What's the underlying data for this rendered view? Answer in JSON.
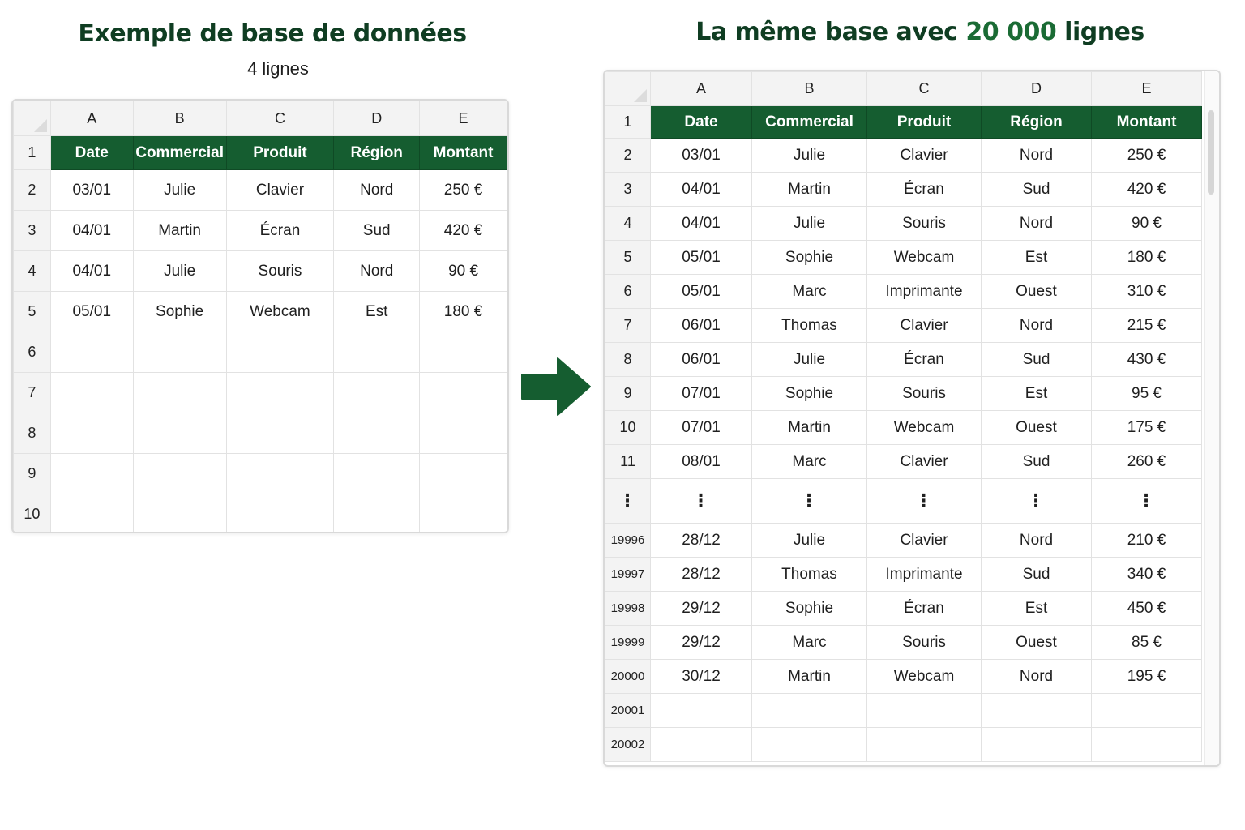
{
  "left": {
    "title": "Exemple de base de données",
    "subtitle": "4 lignes",
    "columns": [
      "A",
      "B",
      "C",
      "D",
      "E"
    ],
    "header_row_num": "1",
    "header": [
      "Date",
      "Commercial",
      "Produit",
      "Région",
      "Montant"
    ],
    "rows": [
      {
        "num": "2",
        "cells": [
          "03/01",
          "Julie",
          "Clavier",
          "Nord",
          "250 €"
        ]
      },
      {
        "num": "3",
        "cells": [
          "04/01",
          "Martin",
          "Écran",
          "Sud",
          "420 €"
        ]
      },
      {
        "num": "4",
        "cells": [
          "04/01",
          "Julie",
          "Souris",
          "Nord",
          "90 €"
        ]
      },
      {
        "num": "5",
        "cells": [
          "05/01",
          "Sophie",
          "Webcam",
          "Est",
          "180 €"
        ]
      },
      {
        "num": "6",
        "cells": [
          "",
          "",
          "",
          "",
          ""
        ]
      },
      {
        "num": "7",
        "cells": [
          "",
          "",
          "",
          "",
          ""
        ]
      },
      {
        "num": "8",
        "cells": [
          "",
          "",
          "",
          "",
          ""
        ]
      },
      {
        "num": "9",
        "cells": [
          "",
          "",
          "",
          "",
          ""
        ]
      },
      {
        "num": "10",
        "cells": [
          "",
          "",
          "",
          "",
          ""
        ]
      }
    ]
  },
  "right": {
    "title_prefix": "La même base avec ",
    "title_highlight": "20 000",
    "title_suffix": " lignes",
    "columns": [
      "A",
      "B",
      "C",
      "D",
      "E"
    ],
    "header_row_num": "1",
    "header": [
      "Date",
      "Commercial",
      "Produit",
      "Région",
      "Montant"
    ],
    "rows": [
      {
        "num": "2",
        "cells": [
          "03/01",
          "Julie",
          "Clavier",
          "Nord",
          "250 €"
        ]
      },
      {
        "num": "3",
        "cells": [
          "04/01",
          "Martin",
          "Écran",
          "Sud",
          "420 €"
        ]
      },
      {
        "num": "4",
        "cells": [
          "04/01",
          "Julie",
          "Souris",
          "Nord",
          "90 €"
        ]
      },
      {
        "num": "5",
        "cells": [
          "05/01",
          "Sophie",
          "Webcam",
          "Est",
          "180 €"
        ]
      },
      {
        "num": "6",
        "cells": [
          "05/01",
          "Marc",
          "Imprimante",
          "Ouest",
          "310 €"
        ]
      },
      {
        "num": "7",
        "cells": [
          "06/01",
          "Thomas",
          "Clavier",
          "Nord",
          "215 €"
        ]
      },
      {
        "num": "8",
        "cells": [
          "06/01",
          "Julie",
          "Écran",
          "Sud",
          "430 €"
        ]
      },
      {
        "num": "9",
        "cells": [
          "07/01",
          "Sophie",
          "Souris",
          "Est",
          "95 €"
        ]
      },
      {
        "num": "10",
        "cells": [
          "07/01",
          "Martin",
          "Webcam",
          "Ouest",
          "175 €"
        ]
      },
      {
        "num": "11",
        "cells": [
          "08/01",
          "Marc",
          "Clavier",
          "Sud",
          "260 €"
        ]
      },
      {
        "num": "⋮",
        "cells": [
          "⋮",
          "⋮",
          "⋮",
          "⋮",
          "⋮"
        ],
        "ellipsis": true
      },
      {
        "num": "19996",
        "cells": [
          "28/12",
          "Julie",
          "Clavier",
          "Nord",
          "210 €"
        ]
      },
      {
        "num": "19997",
        "cells": [
          "28/12",
          "Thomas",
          "Imprimante",
          "Sud",
          "340 €"
        ]
      },
      {
        "num": "19998",
        "cells": [
          "29/12",
          "Sophie",
          "Écran",
          "Est",
          "450 €"
        ]
      },
      {
        "num": "19999",
        "cells": [
          "29/12",
          "Marc",
          "Souris",
          "Ouest",
          "85 €"
        ]
      },
      {
        "num": "20000",
        "cells": [
          "30/12",
          "Martin",
          "Webcam",
          "Nord",
          "195 €"
        ]
      },
      {
        "num": "20001",
        "cells": [
          "",
          "",
          "",
          "",
          ""
        ]
      },
      {
        "num": "20002",
        "cells": [
          "",
          "",
          "",
          "",
          ""
        ]
      }
    ]
  },
  "colors": {
    "header_fill": "#155d30",
    "title_color": "#0f3d22",
    "highlight_color": "#1a6b34",
    "arrow_color": "#155d30"
  },
  "icons": {
    "arrow": "right-arrow-icon",
    "corner": "select-all-corner-icon"
  }
}
